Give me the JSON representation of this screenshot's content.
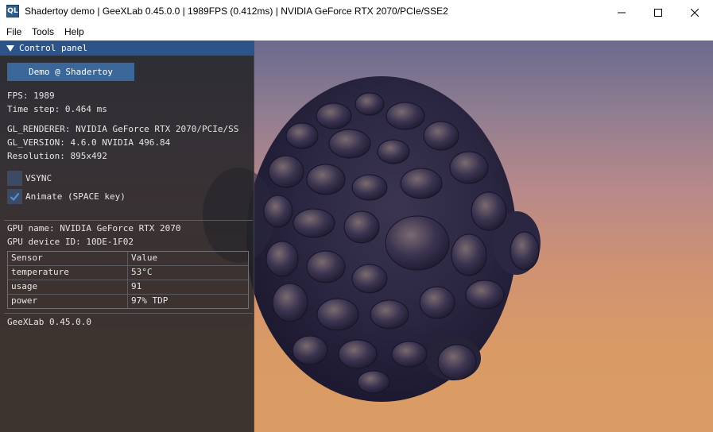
{
  "window": {
    "title": "Shadertoy demo | GeeXLab 0.45.0.0 | 1989FPS (0.412ms) | NVIDIA GeForce RTX 2070/PCIe/SSE2",
    "icon_name": "geexlab-app-icon",
    "icon_text": "QL",
    "controls": [
      "minimize-icon",
      "maximize-icon",
      "close-icon"
    ]
  },
  "menu": {
    "file": "File",
    "tools": "Tools",
    "help": "Help"
  },
  "panel": {
    "header": "Control panel",
    "demo_button": "Demo @ Shadertoy",
    "fps": "FPS: 1989",
    "time_step": "Time step: 0.464 ms",
    "gl_renderer": "GL_RENDERER: NVIDIA GeForce RTX 2070/PCIe/SS",
    "gl_version": "GL_VERSION: 4.6.0 NVIDIA 496.84",
    "resolution": "Resolution: 895x492",
    "vsync_label": "VSYNC",
    "vsync_checked": false,
    "animate_label": "Animate (SPACE key)",
    "animate_checked": true,
    "gpu_name": "GPU name: NVIDIA GeForce RTX 2070",
    "gpu_device_id": "GPU device ID: 10DE-1F02",
    "sensor_table": {
      "headers": [
        "Sensor",
        "Value"
      ],
      "rows": [
        [
          "temperature",
          "53°C"
        ],
        [
          "usage",
          "91"
        ],
        [
          "power",
          "97% TDP"
        ]
      ]
    },
    "footer": "GeeXLab 0.45.0.0"
  },
  "colors": {
    "panel_header": "#2d5488",
    "button": "#3a6797",
    "checkbox": "#3c4a63",
    "check_mark": "#4d8fe0"
  }
}
